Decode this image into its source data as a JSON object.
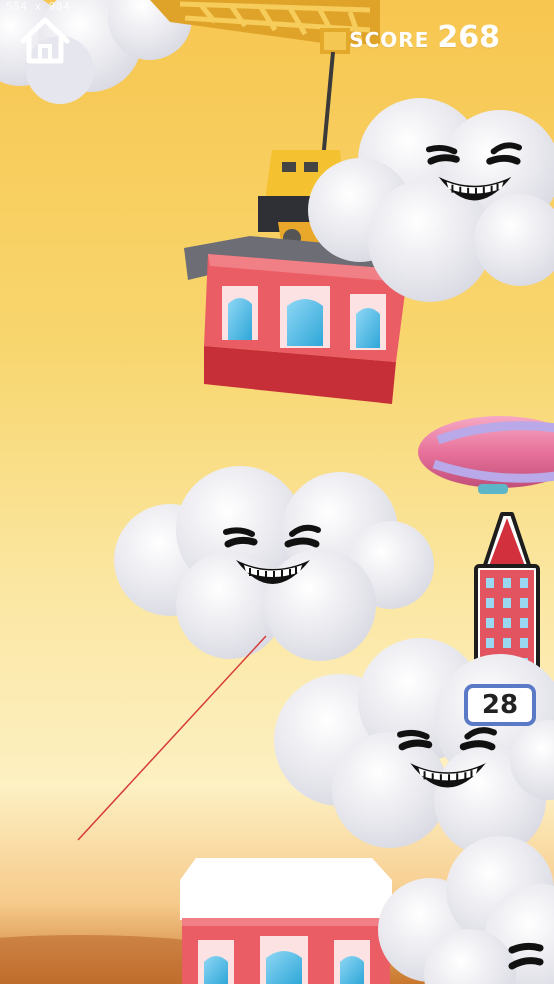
{
  "screen_dimensions_label": "554 x 984",
  "hud": {
    "home_icon": "home-icon",
    "score_label": "SCORE",
    "score_value": "268"
  },
  "tower_indicator": {
    "icon": "tower-icon",
    "floors": "28"
  },
  "colors": {
    "sky_top": "#f7c650",
    "sky_bottom": "#fdf0c2",
    "building_red": "#e8505b",
    "badge_border": "#5a79c6",
    "crane_yellow": "#f0b533",
    "cloud": "#f2f2f6"
  }
}
